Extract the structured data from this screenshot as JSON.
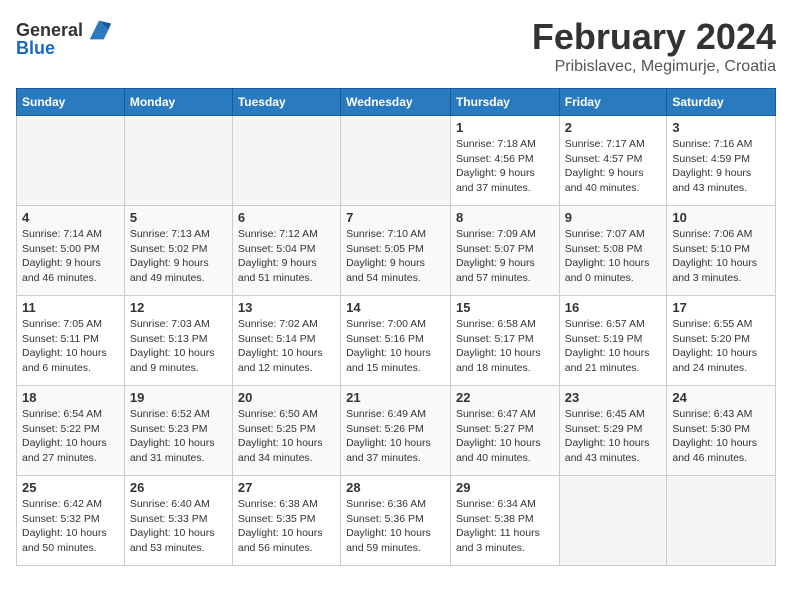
{
  "header": {
    "logo_general": "General",
    "logo_blue": "Blue",
    "month": "February 2024",
    "location": "Pribislavec, Megimurje, Croatia"
  },
  "weekdays": [
    "Sunday",
    "Monday",
    "Tuesday",
    "Wednesday",
    "Thursday",
    "Friday",
    "Saturday"
  ],
  "weeks": [
    [
      {
        "day": "",
        "info": ""
      },
      {
        "day": "",
        "info": ""
      },
      {
        "day": "",
        "info": ""
      },
      {
        "day": "",
        "info": ""
      },
      {
        "day": "1",
        "info": "Sunrise: 7:18 AM\nSunset: 4:56 PM\nDaylight: 9 hours\nand 37 minutes."
      },
      {
        "day": "2",
        "info": "Sunrise: 7:17 AM\nSunset: 4:57 PM\nDaylight: 9 hours\nand 40 minutes."
      },
      {
        "day": "3",
        "info": "Sunrise: 7:16 AM\nSunset: 4:59 PM\nDaylight: 9 hours\nand 43 minutes."
      }
    ],
    [
      {
        "day": "4",
        "info": "Sunrise: 7:14 AM\nSunset: 5:00 PM\nDaylight: 9 hours\nand 46 minutes."
      },
      {
        "day": "5",
        "info": "Sunrise: 7:13 AM\nSunset: 5:02 PM\nDaylight: 9 hours\nand 49 minutes."
      },
      {
        "day": "6",
        "info": "Sunrise: 7:12 AM\nSunset: 5:04 PM\nDaylight: 9 hours\nand 51 minutes."
      },
      {
        "day": "7",
        "info": "Sunrise: 7:10 AM\nSunset: 5:05 PM\nDaylight: 9 hours\nand 54 minutes."
      },
      {
        "day": "8",
        "info": "Sunrise: 7:09 AM\nSunset: 5:07 PM\nDaylight: 9 hours\nand 57 minutes."
      },
      {
        "day": "9",
        "info": "Sunrise: 7:07 AM\nSunset: 5:08 PM\nDaylight: 10 hours\nand 0 minutes."
      },
      {
        "day": "10",
        "info": "Sunrise: 7:06 AM\nSunset: 5:10 PM\nDaylight: 10 hours\nand 3 minutes."
      }
    ],
    [
      {
        "day": "11",
        "info": "Sunrise: 7:05 AM\nSunset: 5:11 PM\nDaylight: 10 hours\nand 6 minutes."
      },
      {
        "day": "12",
        "info": "Sunrise: 7:03 AM\nSunset: 5:13 PM\nDaylight: 10 hours\nand 9 minutes."
      },
      {
        "day": "13",
        "info": "Sunrise: 7:02 AM\nSunset: 5:14 PM\nDaylight: 10 hours\nand 12 minutes."
      },
      {
        "day": "14",
        "info": "Sunrise: 7:00 AM\nSunset: 5:16 PM\nDaylight: 10 hours\nand 15 minutes."
      },
      {
        "day": "15",
        "info": "Sunrise: 6:58 AM\nSunset: 5:17 PM\nDaylight: 10 hours\nand 18 minutes."
      },
      {
        "day": "16",
        "info": "Sunrise: 6:57 AM\nSunset: 5:19 PM\nDaylight: 10 hours\nand 21 minutes."
      },
      {
        "day": "17",
        "info": "Sunrise: 6:55 AM\nSunset: 5:20 PM\nDaylight: 10 hours\nand 24 minutes."
      }
    ],
    [
      {
        "day": "18",
        "info": "Sunrise: 6:54 AM\nSunset: 5:22 PM\nDaylight: 10 hours\nand 27 minutes."
      },
      {
        "day": "19",
        "info": "Sunrise: 6:52 AM\nSunset: 5:23 PM\nDaylight: 10 hours\nand 31 minutes."
      },
      {
        "day": "20",
        "info": "Sunrise: 6:50 AM\nSunset: 5:25 PM\nDaylight: 10 hours\nand 34 minutes."
      },
      {
        "day": "21",
        "info": "Sunrise: 6:49 AM\nSunset: 5:26 PM\nDaylight: 10 hours\nand 37 minutes."
      },
      {
        "day": "22",
        "info": "Sunrise: 6:47 AM\nSunset: 5:27 PM\nDaylight: 10 hours\nand 40 minutes."
      },
      {
        "day": "23",
        "info": "Sunrise: 6:45 AM\nSunset: 5:29 PM\nDaylight: 10 hours\nand 43 minutes."
      },
      {
        "day": "24",
        "info": "Sunrise: 6:43 AM\nSunset: 5:30 PM\nDaylight: 10 hours\nand 46 minutes."
      }
    ],
    [
      {
        "day": "25",
        "info": "Sunrise: 6:42 AM\nSunset: 5:32 PM\nDaylight: 10 hours\nand 50 minutes."
      },
      {
        "day": "26",
        "info": "Sunrise: 6:40 AM\nSunset: 5:33 PM\nDaylight: 10 hours\nand 53 minutes."
      },
      {
        "day": "27",
        "info": "Sunrise: 6:38 AM\nSunset: 5:35 PM\nDaylight: 10 hours\nand 56 minutes."
      },
      {
        "day": "28",
        "info": "Sunrise: 6:36 AM\nSunset: 5:36 PM\nDaylight: 10 hours\nand 59 minutes."
      },
      {
        "day": "29",
        "info": "Sunrise: 6:34 AM\nSunset: 5:38 PM\nDaylight: 11 hours\nand 3 minutes."
      },
      {
        "day": "",
        "info": ""
      },
      {
        "day": "",
        "info": ""
      }
    ]
  ]
}
